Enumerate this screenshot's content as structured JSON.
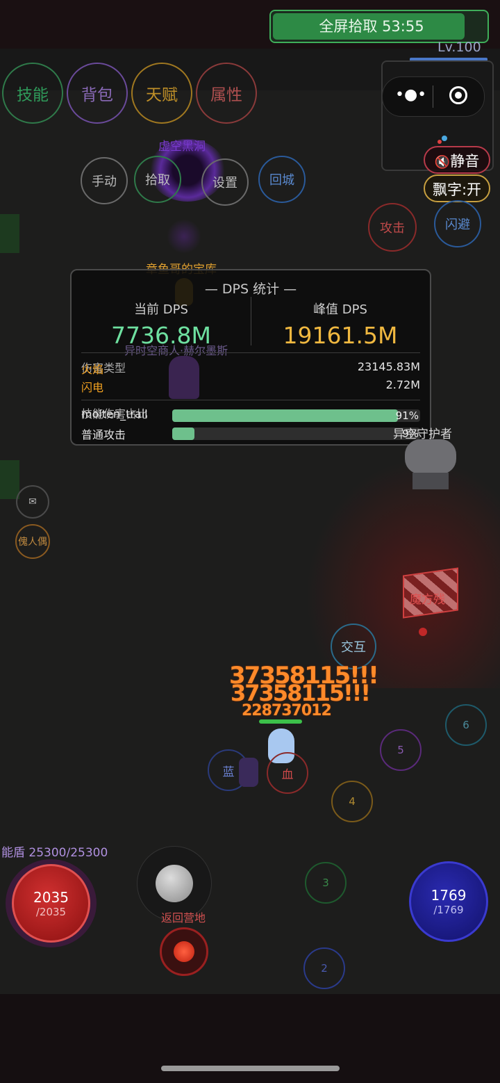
{
  "header": {
    "pickup_label": "全屏拾取 53:55",
    "level": "Lv.100"
  },
  "menu": {
    "skills": "技能",
    "bag": "背包",
    "talent": "天赋",
    "attributes": "属性"
  },
  "quick": {
    "manual": "手动",
    "pickup": "拾取",
    "settings": "设置",
    "return_city": "回城"
  },
  "toggles": {
    "mute": "静音",
    "float_text": "飘字:开"
  },
  "combat": {
    "attack": "攻击",
    "dodge": "闪避",
    "interact": "交互",
    "blue": "蓝",
    "red": "血"
  },
  "world": {
    "portal_name": "虚空黑洞",
    "treasury_name": "章鱼哥的宝库",
    "merchant_name": "异时空商人·赫尔墨斯",
    "guardian_name": "异空守护者",
    "relic_name": "魔方残",
    "mail_icon_label": "✉",
    "puppet_label": "傀人偶"
  },
  "dps_panel": {
    "title": "— DPS 统计 —",
    "current_label": "当前 DPS",
    "current_value": "7736.8M",
    "peak_label": "峰值 DPS",
    "peak_value": "19161.5M",
    "damage_type_header": "伤害类型",
    "damage_types": [
      {
        "name": "火焰",
        "value": "23145.83M",
        "color": "#f0a020"
      },
      {
        "name": "闪电",
        "value": "2.72M",
        "color": "#f0a020"
      }
    ],
    "skill_share_header": "技能伤害占比",
    "skill_shares": [
      {
        "name": "molten_trail",
        "pct": "91%",
        "fraction": 0.91
      },
      {
        "name": "普通攻击",
        "pct": "9%",
        "fraction": 0.09
      }
    ]
  },
  "damage_numbers": [
    "37358115!!!",
    "37358115!!!",
    "228737012"
  ],
  "skill_slots": [
    "6",
    "5",
    "4",
    "3",
    "2"
  ],
  "status": {
    "shield": "能盾 25300/25300",
    "hp_current": "2035",
    "hp_max": "/2035",
    "mp_current": "1769",
    "mp_max": "/1769",
    "return_camp": "返回营地"
  },
  "colors": {
    "green": "#3fae5a",
    "fire": "#f0a020",
    "hp": "#c0262a",
    "mp": "#2a2aa8"
  }
}
